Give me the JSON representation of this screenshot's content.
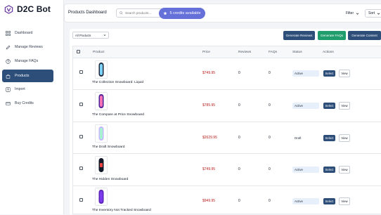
{
  "app": {
    "name": "D2C Bot"
  },
  "sidebar": {
    "items": [
      {
        "label": "Dashboard",
        "icon": "grid-icon",
        "active": false
      },
      {
        "label": "Manage Reviews",
        "icon": "pencil-icon",
        "active": false
      },
      {
        "label": "Manage FAQs",
        "icon": "help-circle-icon",
        "active": false
      },
      {
        "label": "Products",
        "icon": "bag-icon",
        "active": true
      },
      {
        "label": "Import",
        "icon": "upload-icon",
        "active": false
      },
      {
        "label": "Buy Credits",
        "icon": "credit-card-icon",
        "active": false
      }
    ]
  },
  "header": {
    "title": "Products Dashboard",
    "search_placeholder": "Search products...",
    "credits_label": "5 credits available",
    "filter_label": "Filter",
    "sort_label": "Sort"
  },
  "toolbar": {
    "product_filter": "All Products",
    "generate_reviews": "Generate Reviews",
    "generate_faqs": "Generate FAQs",
    "generate_content": "Generate Content"
  },
  "table": {
    "columns": {
      "product": "Product",
      "price": "Price",
      "reviews": "Reviews",
      "faqs": "FAQs",
      "status": "Status",
      "actions": "Actions"
    },
    "select_label": "Select",
    "view_label": "View",
    "rows": [
      {
        "name": "The Collection Snowboard: Liquid",
        "price": "$749.95",
        "reviews": "0",
        "faqs": "0",
        "status": "Active"
      },
      {
        "name": "The Compare at Price Snowboard",
        "price": "$785.95",
        "reviews": "0",
        "faqs": "0",
        "status": "Active"
      },
      {
        "name": "The Draft Snowboard",
        "price": "$2629.95",
        "reviews": "0",
        "faqs": "0",
        "status": "Draft"
      },
      {
        "name": "The Hidden Snowboard",
        "price": "$749.95",
        "reviews": "0",
        "faqs": "0",
        "status": "Active"
      },
      {
        "name": "The Inventory Not Tracked Snowboard",
        "price": "$949.95",
        "reviews": "0",
        "faqs": "0",
        "status": "Active"
      }
    ]
  },
  "colors": {
    "primary": "#2c4e79",
    "success": "#1f9d6c",
    "credits": "#6670d9",
    "price": "#b91c1c",
    "brand": "#6b3fa0"
  }
}
